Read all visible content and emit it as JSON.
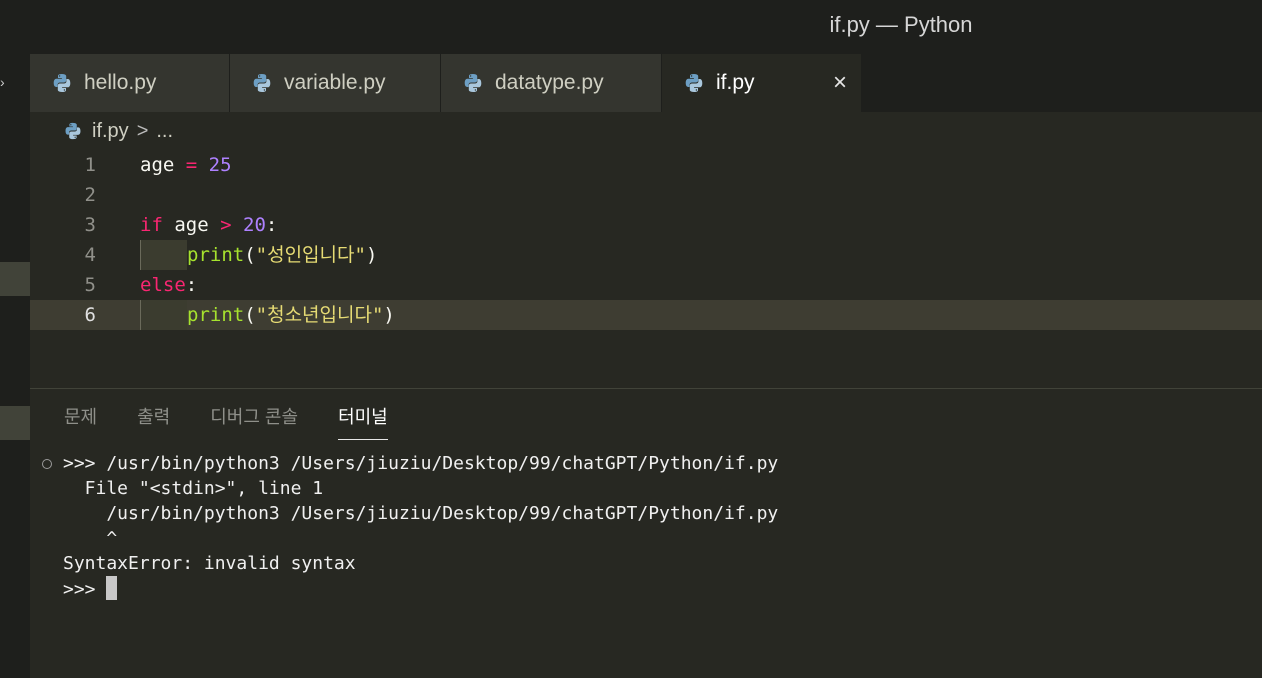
{
  "window": {
    "title": "if.py — Python"
  },
  "tabs": [
    {
      "label": "hello.py"
    },
    {
      "label": "variable.py"
    },
    {
      "label": "datatype.py"
    },
    {
      "label": "if.py",
      "close": "×"
    }
  ],
  "breadcrumb": {
    "file": "if.py",
    "separator": ">",
    "more": "..."
  },
  "editor": {
    "lines": [
      {
        "n": "1",
        "t": [
          [
            "age ",
            ""
          ],
          [
            "=",
            "kw"
          ],
          [
            " ",
            ""
          ],
          [
            "25",
            "num"
          ]
        ]
      },
      {
        "n": "2",
        "t": []
      },
      {
        "n": "3",
        "t": [
          [
            "if",
            "kw"
          ],
          [
            " age ",
            ""
          ],
          [
            ">",
            "kw"
          ],
          [
            " ",
            ""
          ],
          [
            "20",
            "num"
          ],
          [
            ":",
            ""
          ]
        ]
      },
      {
        "n": "4",
        "indent": true,
        "t": [
          [
            "print",
            "fn"
          ],
          [
            "(",
            ""
          ],
          [
            "\"성인입니다\"",
            "str"
          ],
          [
            ")",
            ""
          ]
        ]
      },
      {
        "n": "5",
        "t": [
          [
            "else",
            "kw"
          ],
          [
            ":",
            ""
          ]
        ]
      },
      {
        "n": "6",
        "indent": true,
        "t": [
          [
            "print",
            "fn"
          ],
          [
            "(",
            ""
          ],
          [
            "\"청소년입니다\"",
            "str"
          ],
          [
            ")",
            ""
          ]
        ]
      }
    ]
  },
  "panel": {
    "tabs": [
      "문제",
      "출력",
      "디버그 콘솔",
      "터미널"
    ],
    "terminal": [
      ">>> /usr/bin/python3 /Users/jiuziu/Desktop/99/chatGPT/Python/if.py",
      "  File \"<stdin>\", line 1",
      "    /usr/bin/python3 /Users/jiuziu/Desktop/99/chatGPT/Python/if.py",
      "    ^",
      "SyntaxError: invalid syntax",
      ">>> "
    ]
  },
  "colors": {
    "background": "#272822",
    "keyword": "#f92672",
    "number": "#ae81ff",
    "function": "#a6e22e",
    "string": "#e6db74"
  }
}
